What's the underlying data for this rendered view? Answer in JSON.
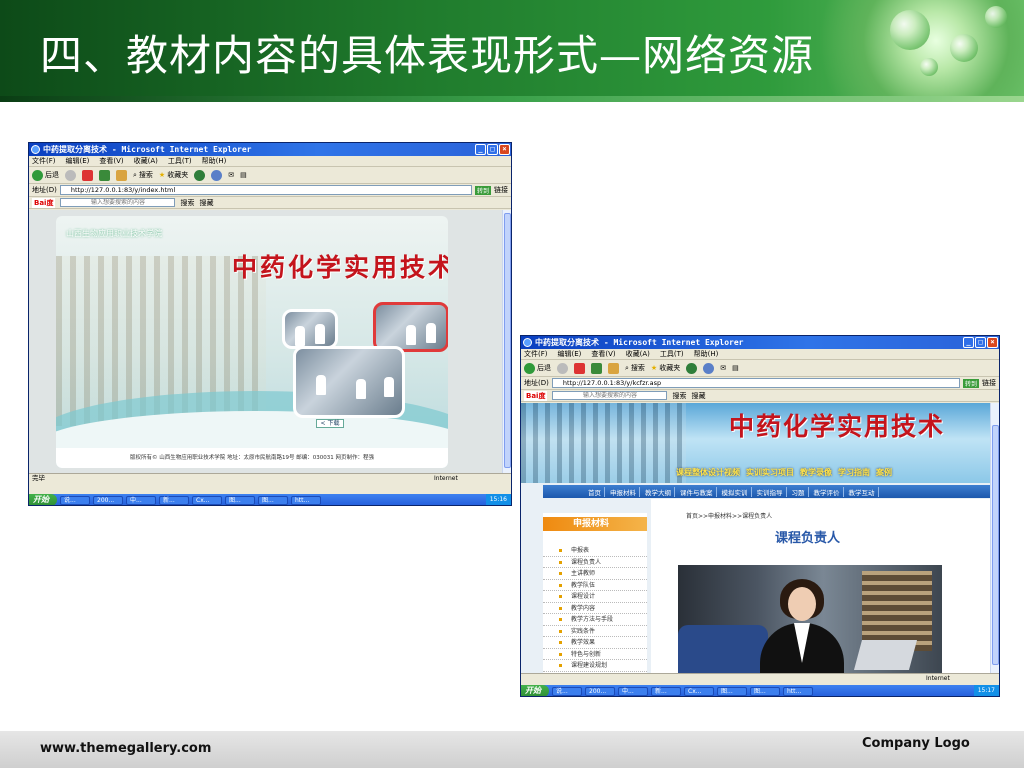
{
  "slide": {
    "title": "四、教材内容的具体表现形式—网络资源",
    "footer_url": "www.themegallery.com",
    "footer_logo": "Company Logo",
    "colors": {
      "header_dark": "#0d4a18",
      "header_light": "#6cc36a",
      "accent_red": "#c4141c",
      "nav_blue": "#1c58ad"
    }
  },
  "browser_left": {
    "window_title": "中药提取分离技术 - Microsoft Internet Explorer",
    "menu": [
      "文件(F)",
      "编辑(E)",
      "查看(V)",
      "收藏(A)",
      "工具(T)",
      "帮助(H)"
    ],
    "toolbar": {
      "back": "后退",
      "search": "搜索",
      "favorites": "收藏夹"
    },
    "address_label": "地址(D)",
    "address_value": "http://127.0.0.1:83/y/index.html",
    "go_label": "转到",
    "links_label": "链接",
    "baidu_logo": "Bai度",
    "baidu_placeholder": "输入想要搜索的内容",
    "baidu_search": "搜索",
    "baidu_news": "搜藏",
    "school_name": "山西生物应用职业技术学院",
    "page_title": "中药化学实用技术",
    "enter_label": "< 下载",
    "page_footer": "版权所有© 山西生物应用职业技术学院 地址：太原市民航南路19号 邮编：030031 网页制作：程强",
    "status_text": "完毕",
    "status_zone": "Internet",
    "start_label": "开始",
    "tasks": [
      "说...",
      "200...",
      "中...",
      "新...",
      "Cx...",
      "图...",
      "图...",
      "htt..."
    ],
    "clock": "15:16"
  },
  "browser_right": {
    "window_title": "中药提取分离技术 - Microsoft Internet Explorer",
    "menu": [
      "文件(F)",
      "编辑(E)",
      "查看(V)",
      "收藏(A)",
      "工具(T)",
      "帮助(H)"
    ],
    "toolbar": {
      "back": "后退",
      "search": "搜索",
      "favorites": "收藏夹"
    },
    "address_label": "地址(D)",
    "address_value": "http://127.0.0.1:83/y/kcfzr.asp",
    "go_label": "转到",
    "links_label": "链接",
    "baidu_logo": "Bai度",
    "baidu_placeholder": "输入想要搜索的内容",
    "baidu_search": "搜索",
    "baidu_news": "搜藏",
    "page_title": "中药化学实用技术",
    "banner_links": [
      "课程整体设计视频",
      "实训实习项目",
      "教学录像",
      "学习指南",
      "案例"
    ],
    "nav": [
      "首页",
      "申报材料",
      "教学大纲",
      "课件与教案",
      "模拟实训",
      "实训指导",
      "习题",
      "教学评价",
      "教学互动"
    ],
    "sidebar_title": "申报材料",
    "sidebar_items": [
      "申报表",
      "课程负责人",
      "主讲教师",
      "教学队伍",
      "课程设计",
      "教学内容",
      "教学方法与手段",
      "实践条件",
      "教学效果",
      "特色与创新",
      "课程建设规划"
    ],
    "breadcrumb": "首页>>申报材料>>课程负责人",
    "content_heading": "课程负责人",
    "status_zone": "Internet",
    "start_label": "开始",
    "tasks": [
      "说...",
      "200...",
      "中...",
      "新...",
      "Cx...",
      "图...",
      "图...",
      "htt..."
    ],
    "clock": "15:17"
  }
}
